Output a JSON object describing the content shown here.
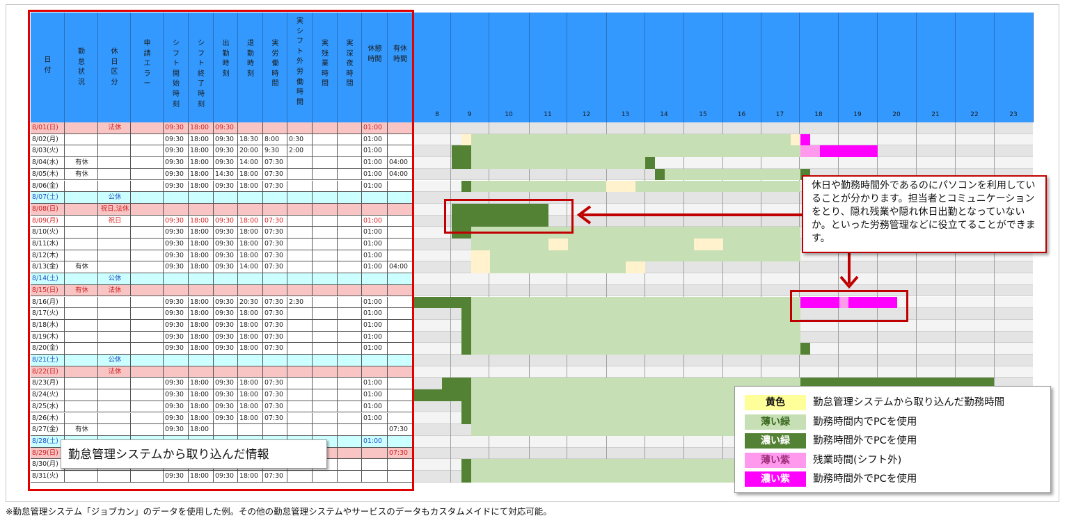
{
  "colors": {
    "header_blue": "#3399ff",
    "sat_row": "#ccffff",
    "sun_row": "#f8c4c4",
    "yellow": "#fff2cc",
    "light_green": "#c6dfb4",
    "dark_green": "#548235",
    "light_purple": "#ff99ee",
    "dark_purple": "#ff00ff",
    "red_frame": "#c00000",
    "gray_stripe": "#dcdcdc"
  },
  "headers": [
    "日付",
    "勤怠状況",
    "休日区分",
    "申請エラー",
    "シフト開始時刻",
    "シフト終了時刻",
    "出勤時刻",
    "退勤時刻",
    "実労働時間",
    "実シフト外労働時間",
    "実残業時間",
    "実深夜時間",
    "休憩時間",
    "有休時間"
  ],
  "hours": [
    "8",
    "9",
    "10",
    "11",
    "12",
    "13",
    "14",
    "15",
    "16",
    "17",
    "18",
    "19",
    "20",
    "21",
    "22",
    "23"
  ],
  "rows": [
    {
      "type": "sun",
      "cells": [
        "8/01(日)",
        "",
        "法休",
        "",
        "09:30",
        "18:00",
        "09:30",
        "",
        "",
        "",
        "",
        "",
        "01:00",
        ""
      ]
    },
    {
      "type": "wk",
      "cells": [
        "8/02(月)",
        "",
        "",
        "",
        "09:30",
        "18:00",
        "09:30",
        "18:30",
        "8:00",
        "0:30",
        "",
        "",
        "01:00",
        ""
      ]
    },
    {
      "type": "wk",
      "cells": [
        "8/03(火)",
        "",
        "",
        "",
        "09:30",
        "18:00",
        "09:30",
        "20:00",
        "9:30",
        "2:00",
        "",
        "",
        "01:00",
        ""
      ]
    },
    {
      "type": "wk",
      "cells": [
        "8/04(水)",
        "有休",
        "",
        "",
        "09:30",
        "18:00",
        "09:30",
        "14:00",
        "07:30",
        "",
        "",
        "",
        "01:00",
        "04:00"
      ]
    },
    {
      "type": "wk",
      "cells": [
        "8/05(木)",
        "有休",
        "",
        "",
        "09:30",
        "18:00",
        "14:30",
        "18:00",
        "07:30",
        "",
        "",
        "",
        "01:00",
        "04:00"
      ]
    },
    {
      "type": "wk",
      "cells": [
        "8/06(金)",
        "",
        "",
        "",
        "09:30",
        "18:00",
        "09:30",
        "18:00",
        "07:30",
        "",
        "",
        "",
        "01:00",
        ""
      ]
    },
    {
      "type": "sat",
      "cells": [
        "8/07(土)",
        "",
        "公休",
        "",
        "",
        "",
        "",
        "",
        "",
        "",
        "",
        "",
        "",
        ""
      ]
    },
    {
      "type": "sun",
      "cells": [
        "8/08(日)",
        "",
        "祝日,法休",
        "",
        "",
        "",
        "",
        "",
        "",
        "",
        "",
        "",
        "",
        ""
      ]
    },
    {
      "type": "hol",
      "cells": [
        "8/09(月)",
        "",
        "祝日",
        "",
        "09:30",
        "18:00",
        "09:30",
        "18:00",
        "07:30",
        "",
        "",
        "",
        "01:00",
        ""
      ]
    },
    {
      "type": "wk",
      "cells": [
        "8/10(火)",
        "",
        "",
        "",
        "09:30",
        "18:00",
        "09:30",
        "18:00",
        "07:30",
        "",
        "",
        "",
        "01:00",
        ""
      ]
    },
    {
      "type": "wk",
      "cells": [
        "8/11(水)",
        "",
        "",
        "",
        "09:30",
        "18:00",
        "09:30",
        "18:00",
        "07:30",
        "",
        "",
        "",
        "01:00",
        ""
      ]
    },
    {
      "type": "wk",
      "cells": [
        "8/12(木)",
        "",
        "",
        "",
        "09:30",
        "18:00",
        "09:30",
        "18:00",
        "07:30",
        "",
        "",
        "",
        "01:00",
        ""
      ]
    },
    {
      "type": "wk",
      "cells": [
        "8/13(金)",
        "有休",
        "",
        "",
        "09:30",
        "18:00",
        "09:30",
        "14:00",
        "07:30",
        "",
        "",
        "",
        "01:00",
        "04:00"
      ]
    },
    {
      "type": "sat",
      "cells": [
        "8/14(土)",
        "",
        "公休",
        "",
        "",
        "",
        "",
        "",
        "",
        "",
        "",
        "",
        "",
        ""
      ]
    },
    {
      "type": "sun",
      "cells": [
        "8/15(日)",
        "有休",
        "法休",
        "",
        "",
        "",
        "",
        "",
        "",
        "",
        "",
        "",
        "",
        ""
      ]
    },
    {
      "type": "wk",
      "cells": [
        "8/16(月)",
        "",
        "",
        "",
        "09:30",
        "18:00",
        "09:30",
        "20:30",
        "07:30",
        "2:30",
        "",
        "",
        "01:00",
        ""
      ]
    },
    {
      "type": "wk",
      "cells": [
        "8/17(火)",
        "",
        "",
        "",
        "09:30",
        "18:00",
        "09:30",
        "18:00",
        "07:30",
        "",
        "",
        "",
        "01:00",
        ""
      ]
    },
    {
      "type": "wk",
      "cells": [
        "8/18(水)",
        "",
        "",
        "",
        "09:30",
        "18:00",
        "09:30",
        "18:00",
        "07:30",
        "",
        "",
        "",
        "01:00",
        ""
      ]
    },
    {
      "type": "wk",
      "cells": [
        "8/19(木)",
        "",
        "",
        "",
        "09:30",
        "18:00",
        "09:30",
        "18:00",
        "07:30",
        "",
        "",
        "",
        "01:00",
        ""
      ]
    },
    {
      "type": "wk",
      "cells": [
        "8/20(金)",
        "",
        "",
        "",
        "09:30",
        "18:00",
        "09:30",
        "18:00",
        "07:30",
        "",
        "",
        "",
        "01:00",
        ""
      ]
    },
    {
      "type": "sat",
      "cells": [
        "8/21(土)",
        "",
        "公休",
        "",
        "",
        "",
        "",
        "",
        "",
        "",
        "",
        "",
        "",
        ""
      ]
    },
    {
      "type": "sun",
      "cells": [
        "8/22(日)",
        "",
        "法休",
        "",
        "",
        "",
        "",
        "",
        "",
        "",
        "",
        "",
        "",
        ""
      ]
    },
    {
      "type": "wk",
      "cells": [
        "8/23(月)",
        "",
        "",
        "",
        "09:30",
        "18:00",
        "09:30",
        "18:00",
        "07:30",
        "",
        "",
        "",
        "01:00",
        ""
      ]
    },
    {
      "type": "wk",
      "cells": [
        "8/24(火)",
        "",
        "",
        "",
        "09:30",
        "18:00",
        "09:30",
        "18:00",
        "07:30",
        "",
        "",
        "",
        "01:00",
        ""
      ]
    },
    {
      "type": "wk",
      "cells": [
        "8/25(水)",
        "",
        "",
        "",
        "09:30",
        "18:00",
        "09:30",
        "18:00",
        "07:30",
        "",
        "",
        "",
        "01:00",
        ""
      ]
    },
    {
      "type": "wk",
      "cells": [
        "8/26(木)",
        "",
        "",
        "",
        "09:30",
        "18:00",
        "09:30",
        "18:00",
        "07:30",
        "",
        "",
        "",
        "01:00",
        ""
      ]
    },
    {
      "type": "wk",
      "cells": [
        "8/27(金)",
        "有休",
        "",
        "",
        "09:30",
        "18:00",
        "",
        "",
        "",
        "",
        "",
        "",
        "",
        "07:30"
      ]
    },
    {
      "type": "sat",
      "cells": [
        "8/28(土)",
        "",
        "",
        "",
        "",
        "",
        "",
        "",
        "",
        "",
        "",
        "",
        "01:00",
        ""
      ]
    },
    {
      "type": "sun",
      "cells": [
        "8/29(日)",
        "",
        "",
        "",
        "",
        "",
        "",
        "",
        "",
        "",
        "",
        "",
        "",
        "07:30"
      ]
    },
    {
      "type": "wk",
      "cells": [
        "8/30(月)",
        "",
        "",
        "",
        "09:30",
        "18:00",
        "09:30",
        "18:00",
        "07:30",
        "",
        "",
        "",
        "",
        ""
      ]
    },
    {
      "type": "wk",
      "cells": [
        "8/31(火)",
        "",
        "",
        "",
        "09:30",
        "18:00",
        "09:30",
        "18:00",
        "07:30",
        "",
        "",
        "",
        "",
        ""
      ]
    }
  ],
  "info_label": "勤怠管理システムから取り込んだ情報",
  "callout_text": "休日や勤務時間外であるのにパソコンを利用していることが分かります。担当者とコミュニケーションをとり、隠れ残業や隠れ休日出勤となっていないか。といった労務管理などに役立てることができます。",
  "legend": [
    {
      "swatch": "黄色",
      "text": "勤怠管理システムから取り込んだ勤務時間",
      "bg": "#ffff99",
      "fg": "#111111"
    },
    {
      "swatch": "薄い緑",
      "text": "勤務時間内でPCを使用",
      "bg": "#c6dfb4",
      "fg": "#3a6a20"
    },
    {
      "swatch": "濃い緑",
      "text": "勤務時間外でPCを使用",
      "bg": "#548235",
      "fg": "#ffffff"
    },
    {
      "swatch": "薄い紫",
      "text": "残業時間(シフト外)",
      "bg": "#ff99ee",
      "fg": "#a0307a"
    },
    {
      "swatch": "濃い紫",
      "text": "勤務時間外でPCを使用",
      "bg": "#ff00ff",
      "fg": "#ffffff"
    }
  ],
  "footnote": "※勤怠管理システム「ジョブカン」のデータを使用した例。その他の勤怠管理システムやサービスのデータもカスタムメイドにて対応可能。"
}
